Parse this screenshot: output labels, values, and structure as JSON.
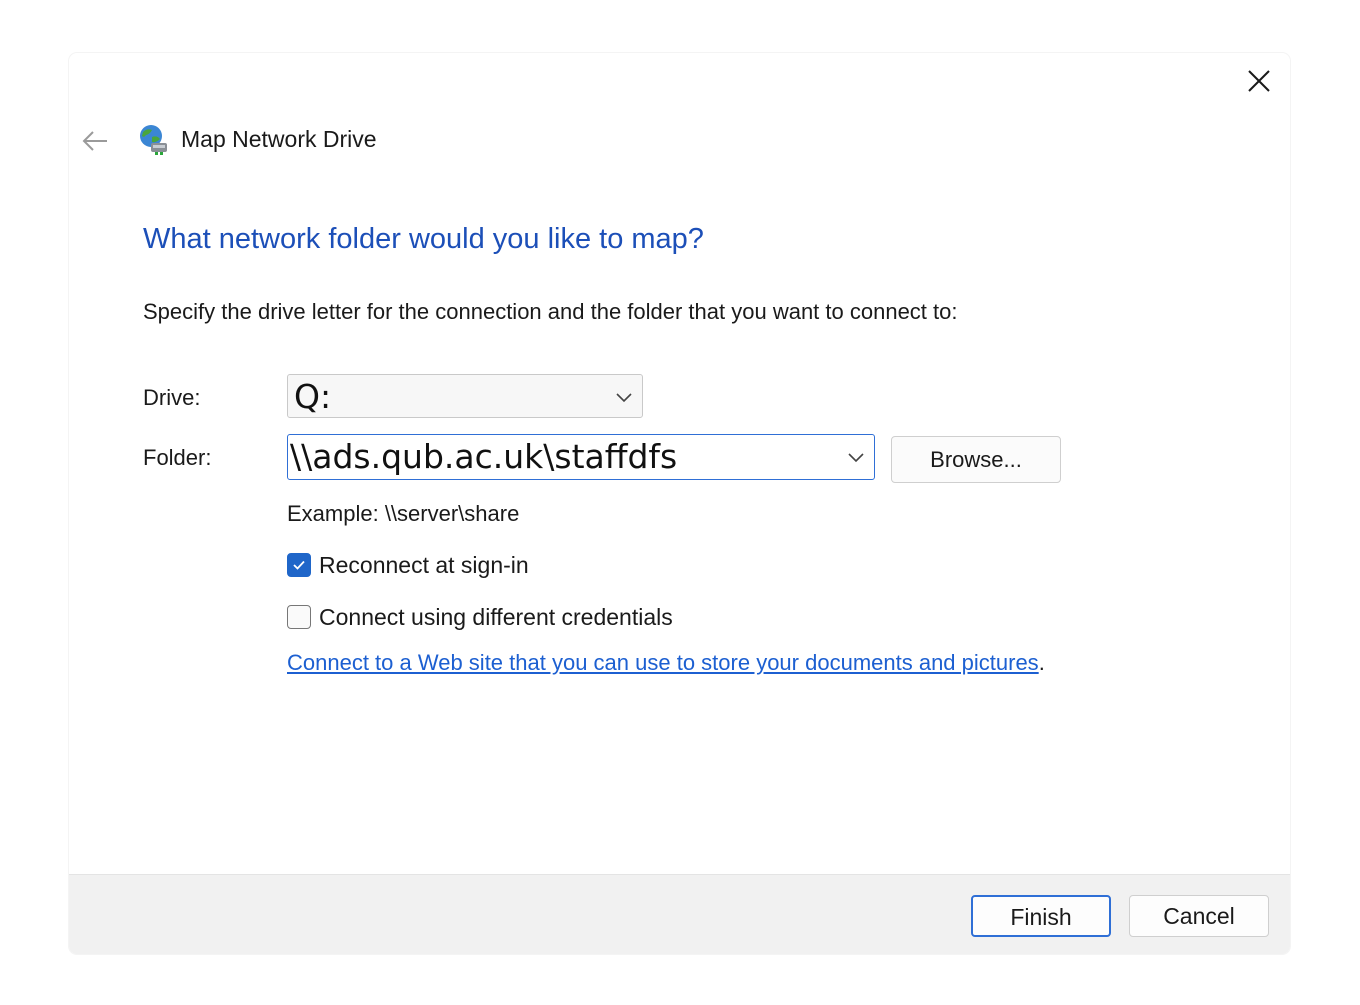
{
  "window": {
    "title": "Map Network Drive",
    "close_icon": "close-icon",
    "back_icon": "arrow-left-icon",
    "app_icon": "network-drive-icon"
  },
  "main": {
    "heading": "What network folder would you like to map?",
    "instructions": "Specify the drive letter for the connection and the folder that you want to connect to:",
    "drive": {
      "label": "Drive:",
      "value": "Q:"
    },
    "folder": {
      "label": "Folder:",
      "value": "\\\\ads.qub.ac.uk\\staffdfs",
      "browse_label": "Browse..."
    },
    "example": "Example: \\\\server\\share",
    "options": {
      "reconnect": {
        "label": "Reconnect at sign-in",
        "checked": true
      },
      "different_credentials": {
        "label": "Connect using different credentials",
        "checked": false
      }
    },
    "weblink": {
      "text": "Connect to a Web site that you can use to store your documents and pictures",
      "trailing": "."
    }
  },
  "footer": {
    "finish_label": "Finish",
    "cancel_label": "Cancel"
  },
  "colors": {
    "heading": "#1c4fb8",
    "link": "#1c5fd1",
    "accent": "#1f66c9",
    "footer_bg": "#f1f1f1"
  }
}
